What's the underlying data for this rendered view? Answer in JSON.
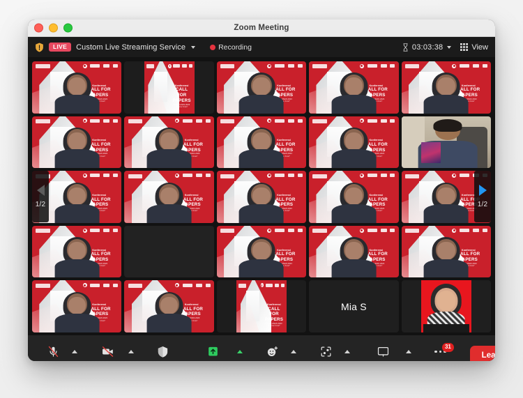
{
  "window": {
    "title": "Zoom Meeting",
    "controls": [
      "close",
      "minimize",
      "maximize"
    ]
  },
  "topbar": {
    "shield_icon": "shield-icon",
    "live_badge": "LIVE",
    "stream_service": "Custom Live Streaming Service",
    "stream_chevron_icon": "chevron-down-icon",
    "recording_label": "Recording",
    "recording_dot_icon": "record-dot-icon",
    "timer_icon": "hourglass-icon",
    "timer": "03:03:38",
    "timer_chevron_icon": "chevron-down-icon",
    "view_icon": "grid-view-icon",
    "view_label": "View"
  },
  "gallery": {
    "columns": 5,
    "rows": 5,
    "active_speaker_index": 3,
    "nav_left": {
      "icon": "arrow-left-icon",
      "page": "1/2"
    },
    "nav_right": {
      "icon": "arrow-right-icon",
      "page": "1/2"
    },
    "virtual_background": {
      "line1": "Konferensi",
      "line2": "CALL FOR PAPERS",
      "line3": "PPSN-UNAS 2023",
      "line4": "\"Seminar Ilmiah\""
    },
    "tiles": [
      {
        "index": 0,
        "kind": "video",
        "name": "",
        "active": false
      },
      {
        "index": 1,
        "kind": "slide",
        "name": "",
        "active": false
      },
      {
        "index": 2,
        "kind": "video",
        "name": "",
        "active": false
      },
      {
        "index": 3,
        "kind": "video",
        "name": "",
        "active": true
      },
      {
        "index": 4,
        "kind": "video",
        "name": "",
        "active": false
      },
      {
        "index": 5,
        "kind": "video",
        "name": "",
        "active": false
      },
      {
        "index": 6,
        "kind": "video",
        "name": "",
        "active": false
      },
      {
        "index": 7,
        "kind": "video",
        "name": "",
        "active": false
      },
      {
        "index": 8,
        "kind": "video",
        "name": "",
        "active": false
      },
      {
        "index": 9,
        "kind": "office",
        "name": "",
        "active": false
      },
      {
        "index": 10,
        "kind": "video",
        "name": "",
        "active": false
      },
      {
        "index": 11,
        "kind": "video",
        "name": "",
        "active": false
      },
      {
        "index": 12,
        "kind": "video",
        "name": "",
        "active": false
      },
      {
        "index": 13,
        "kind": "video",
        "name": "",
        "active": false
      },
      {
        "index": 14,
        "kind": "video",
        "name": "",
        "active": false
      },
      {
        "index": 15,
        "kind": "video",
        "name": "",
        "active": false
      },
      {
        "index": 16,
        "kind": "plain",
        "name": "",
        "active": false
      },
      {
        "index": 17,
        "kind": "video",
        "name": "",
        "active": false
      },
      {
        "index": 18,
        "kind": "video",
        "name": "",
        "active": false
      },
      {
        "index": 19,
        "kind": "video",
        "name": "",
        "active": false
      },
      {
        "index": 20,
        "kind": "video",
        "name": "",
        "active": false
      },
      {
        "index": 21,
        "kind": "video",
        "name": "",
        "active": false
      },
      {
        "index": 22,
        "kind": "slide",
        "name": "",
        "active": false
      },
      {
        "index": 23,
        "kind": "name",
        "name": "Mia S",
        "active": false
      },
      {
        "index": 24,
        "kind": "photo",
        "name": "",
        "active": false
      }
    ]
  },
  "toolbar": {
    "items": [
      {
        "label": "Unmute",
        "icon": "microphone-muted-icon",
        "caret": true,
        "accent": false
      },
      {
        "label": "Start Video",
        "icon": "camera-off-icon",
        "caret": true,
        "accent": false
      },
      {
        "label": "Security",
        "icon": "shield-icon",
        "caret": false,
        "accent": false
      },
      {
        "label": "Share Screen",
        "icon": "share-screen-icon",
        "caret": true,
        "accent": true
      },
      {
        "label": "Reactions",
        "icon": "reactions-icon",
        "caret": true,
        "accent": false
      },
      {
        "label": "Apps",
        "icon": "apps-icon",
        "caret": true,
        "accent": false
      },
      {
        "label": "Whiteboards",
        "icon": "whiteboard-icon",
        "caret": true,
        "accent": false
      },
      {
        "label": "More",
        "icon": "more-dots-icon",
        "caret": false,
        "accent": false,
        "badge": "31"
      }
    ],
    "leave_label": "Leave"
  },
  "colors": {
    "accent_green": "#3ad36a",
    "leave_red": "#e02d2d",
    "live_red": "#e8485f",
    "badge_red": "#e02020",
    "active_border": "#2dbe4e",
    "nav_blue": "#2196f3",
    "brand_red": "#c9202b"
  }
}
